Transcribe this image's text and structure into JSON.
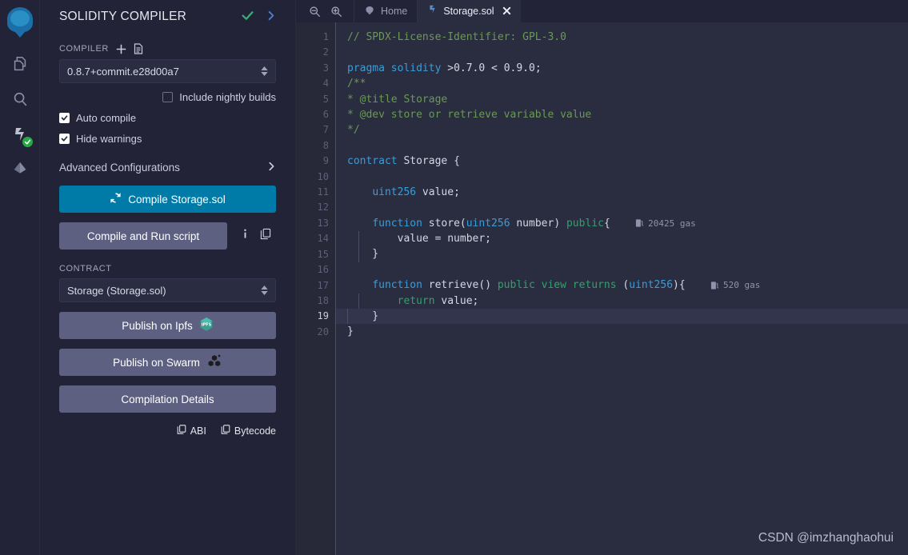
{
  "rail": {
    "items": [
      {
        "name": "remix-logo",
        "label": "Remix"
      },
      {
        "name": "file-explorer",
        "label": "File explorers"
      },
      {
        "name": "search",
        "label": "Search in files"
      },
      {
        "name": "solidity-compiler",
        "label": "Solidity compiler"
      },
      {
        "name": "deploy-run",
        "label": "Deploy & run transactions"
      }
    ]
  },
  "panel": {
    "title": "SOLIDITY COMPILER",
    "compiler_label": "COMPILER",
    "compiler_version": "0.8.7+commit.e28d00a7",
    "nightly_label": "Include nightly builds",
    "nightly_checked": false,
    "auto_compile_label": "Auto compile",
    "auto_compile_checked": true,
    "hide_warnings_label": "Hide warnings",
    "hide_warnings_checked": true,
    "advanced_label": "Advanced Configurations",
    "compile_button": "Compile Storage.sol",
    "compile_and_run_button": "Compile and Run script",
    "contract_label": "CONTRACT",
    "contract_value": "Storage (Storage.sol)",
    "publish_ipfs": "Publish on Ipfs",
    "publish_swarm": "Publish on Swarm",
    "compilation_details": "Compilation Details",
    "abi_label": "ABI",
    "bytecode_label": "Bytecode",
    "ipfs_badge": "IPFS",
    "accent_primary": "#007aa6",
    "accent_secondary": "#5d6080",
    "status_ok_color": "#2bb673"
  },
  "editor": {
    "tabs": [
      {
        "label": "Home",
        "icon": "remix-icon",
        "active": false,
        "closable": false
      },
      {
        "label": "Storage.sol",
        "icon": "solidity-icon",
        "active": true,
        "closable": true
      }
    ],
    "zoom_out": "zoom-out-icon",
    "zoom_in": "zoom-in-icon",
    "active_line": 19,
    "line_count": 20,
    "lines": [
      "// SPDX-License-Identifier: GPL-3.0",
      "",
      "pragma solidity >0.7.0 < 0.9.0;",
      "/**",
      "* @title Storage",
      "* @dev store or retrieve variable value",
      "*/",
      "",
      "contract Storage {",
      "",
      "    uint256 value;",
      "",
      "    function store(uint256 number) public{",
      "        value = number;",
      "    }",
      "",
      "    function retrieve() public view returns (uint256){",
      "        return value;",
      "    }",
      "}"
    ],
    "gas_annotations": [
      {
        "line": 13,
        "text": "20425 gas"
      },
      {
        "line": 17,
        "text": "520 gas"
      }
    ]
  },
  "watermark": "CSDN @imzhanghaohui"
}
